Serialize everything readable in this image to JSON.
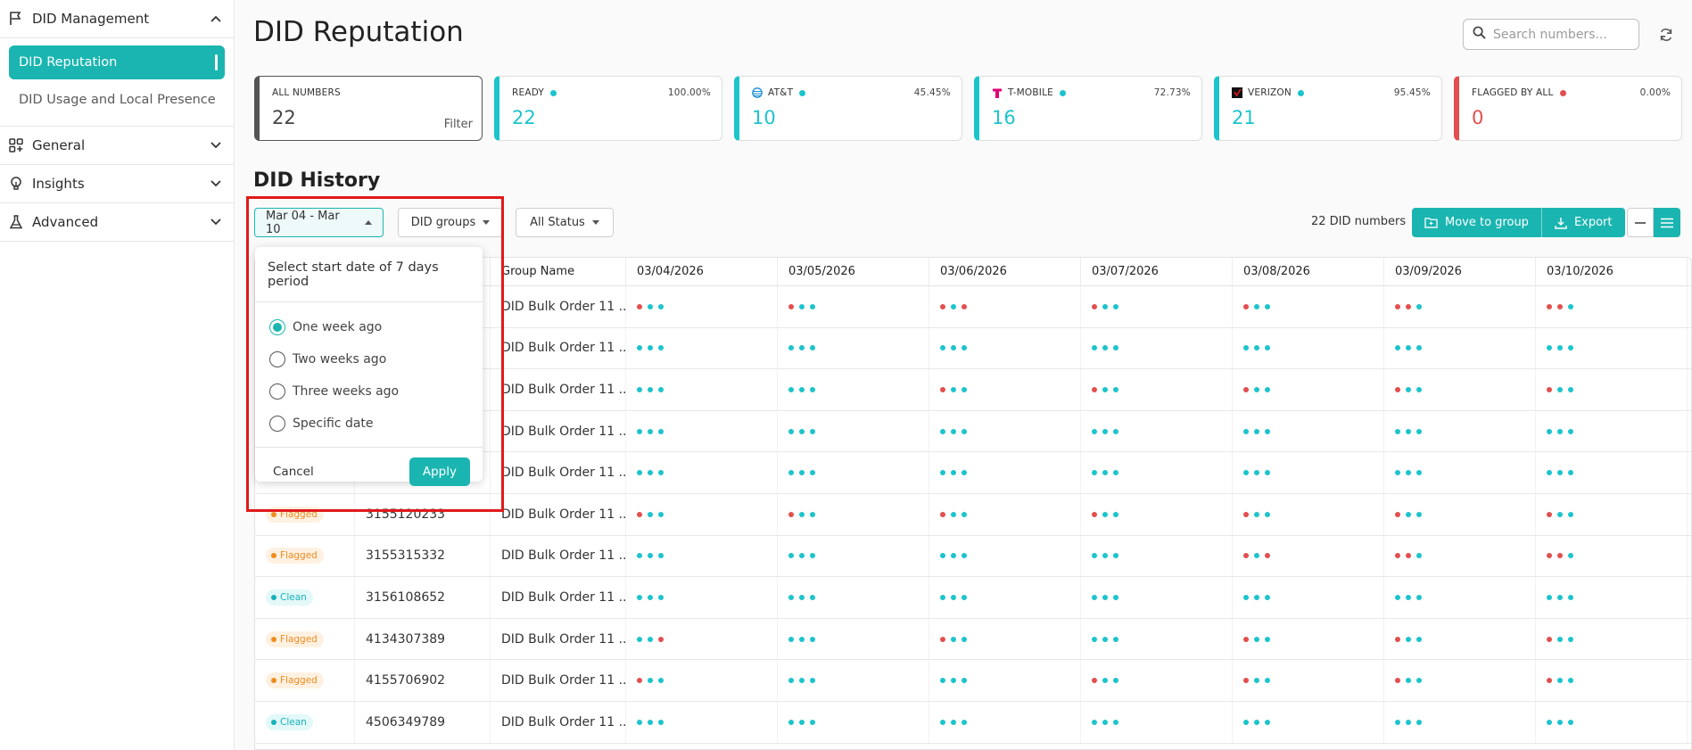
{
  "sidebar": {
    "sections": [
      {
        "label": "DID Management",
        "icon": "flag-icon",
        "expanded": true
      },
      {
        "label": "General",
        "icon": "widgets-icon",
        "expanded": false
      },
      {
        "label": "Insights",
        "icon": "lightbulb-icon",
        "expanded": false
      },
      {
        "label": "Advanced",
        "icon": "flask-icon",
        "expanded": false
      }
    ],
    "items": [
      {
        "label": "DID Reputation",
        "active": true
      },
      {
        "label": "DID Usage and Local Presence",
        "active": false
      }
    ]
  },
  "header": {
    "title": "DID Reputation",
    "search_placeholder": "Search numbers..."
  },
  "cards": [
    {
      "label": "ALL NUMBERS",
      "value": "22",
      "percent": "",
      "action": "Filter"
    },
    {
      "label": "READY",
      "value": "22",
      "percent": "100.00%"
    },
    {
      "label": "AT&T",
      "value": "10",
      "percent": "45.45%"
    },
    {
      "label": "T-MOBILE",
      "value": "16",
      "percent": "72.73%"
    },
    {
      "label": "VERIZON",
      "value": "21",
      "percent": "95.45%"
    },
    {
      "label": "FLAGGED BY ALL",
      "value": "0",
      "percent": "0.00%"
    }
  ],
  "history": {
    "title": "DID History",
    "date_range": "Mar 04 - Mar 10",
    "groups_label": "DID groups",
    "status_label": "All Status",
    "count_label": "22 DID numbers",
    "move_label": "Move to group",
    "export_label": "Export"
  },
  "table": {
    "headers": [
      "",
      "",
      "Group Name",
      "03/04/2026",
      "03/05/2026",
      "03/06/2026",
      "03/07/2026",
      "03/08/2026",
      "03/09/2026",
      "03/10/2026"
    ],
    "rows": [
      {
        "status": "",
        "number": "",
        "group": "DID Bulk Order 11 ...",
        "days": [
          "rgg",
          "rgg",
          "rgr",
          "rgg",
          "rgg",
          "rrg",
          "rrg"
        ]
      },
      {
        "status": "",
        "number": "",
        "group": "DID Bulk Order 11 ...",
        "days": [
          "ggg",
          "ggg",
          "ggg",
          "ggg",
          "ggg",
          "ggg",
          "ggg"
        ]
      },
      {
        "status": "",
        "number": "",
        "group": "DID Bulk Order 11 ...",
        "days": [
          "ggg",
          "ggg",
          "rgg",
          "rgg",
          "rgg",
          "rgg",
          "rgg"
        ]
      },
      {
        "status": "",
        "number": "",
        "group": "DID Bulk Order 11 ...",
        "days": [
          "ggg",
          "ggg",
          "ggg",
          "ggg",
          "ggg",
          "ggg",
          "ggg"
        ]
      },
      {
        "status": "",
        "number": "",
        "group": "DID Bulk Order 11 ...",
        "days": [
          "ggg",
          "ggg",
          "ggg",
          "ggg",
          "ggg",
          "ggg",
          "ggg"
        ]
      },
      {
        "status": "Flagged",
        "number": "3155120233",
        "group": "DID Bulk Order 11 ...",
        "days": [
          "rgg",
          "rgg",
          "rgg",
          "rgg",
          "rgg",
          "rgg",
          "rgg"
        ]
      },
      {
        "status": "Flagged",
        "number": "3155315332",
        "group": "DID Bulk Order 11 ...",
        "days": [
          "ggg",
          "ggg",
          "ggg",
          "ggg",
          "rgr",
          "rrg",
          "rrg"
        ]
      },
      {
        "status": "Clean",
        "number": "3156108652",
        "group": "DID Bulk Order 11 ...",
        "days": [
          "ggg",
          "ggg",
          "ggg",
          "ggg",
          "ggg",
          "ggg",
          "ggg"
        ]
      },
      {
        "status": "Flagged",
        "number": "4134307389",
        "group": "DID Bulk Order 11 ...",
        "days": [
          "ggr",
          "ggg",
          "rgg",
          "ggg",
          "rgg",
          "rgg",
          "rgg"
        ]
      },
      {
        "status": "Flagged",
        "number": "4155706902",
        "group": "DID Bulk Order 11 ...",
        "days": [
          "rgg",
          "ggg",
          "ggg",
          "rgg",
          "rgg",
          "rgg",
          "rgg"
        ]
      },
      {
        "status": "Clean",
        "number": "4506349789",
        "group": "DID Bulk Order 11 ...",
        "days": [
          "ggg",
          "ggg",
          "ggg",
          "ggg",
          "ggg",
          "ggg",
          "ggg"
        ]
      }
    ]
  },
  "popup": {
    "title": "Select start date of 7 days period",
    "options": [
      "One week ago",
      "Two weeks ago",
      "Three weeks ago",
      "Specific date"
    ],
    "selected": 0,
    "cancel_label": "Cancel",
    "apply_label": "Apply"
  },
  "colors": {
    "accent": "#1ab5b0",
    "ok": "#1cc4cc",
    "bad": "#e24f4f",
    "flagged": "#f08b1c"
  }
}
